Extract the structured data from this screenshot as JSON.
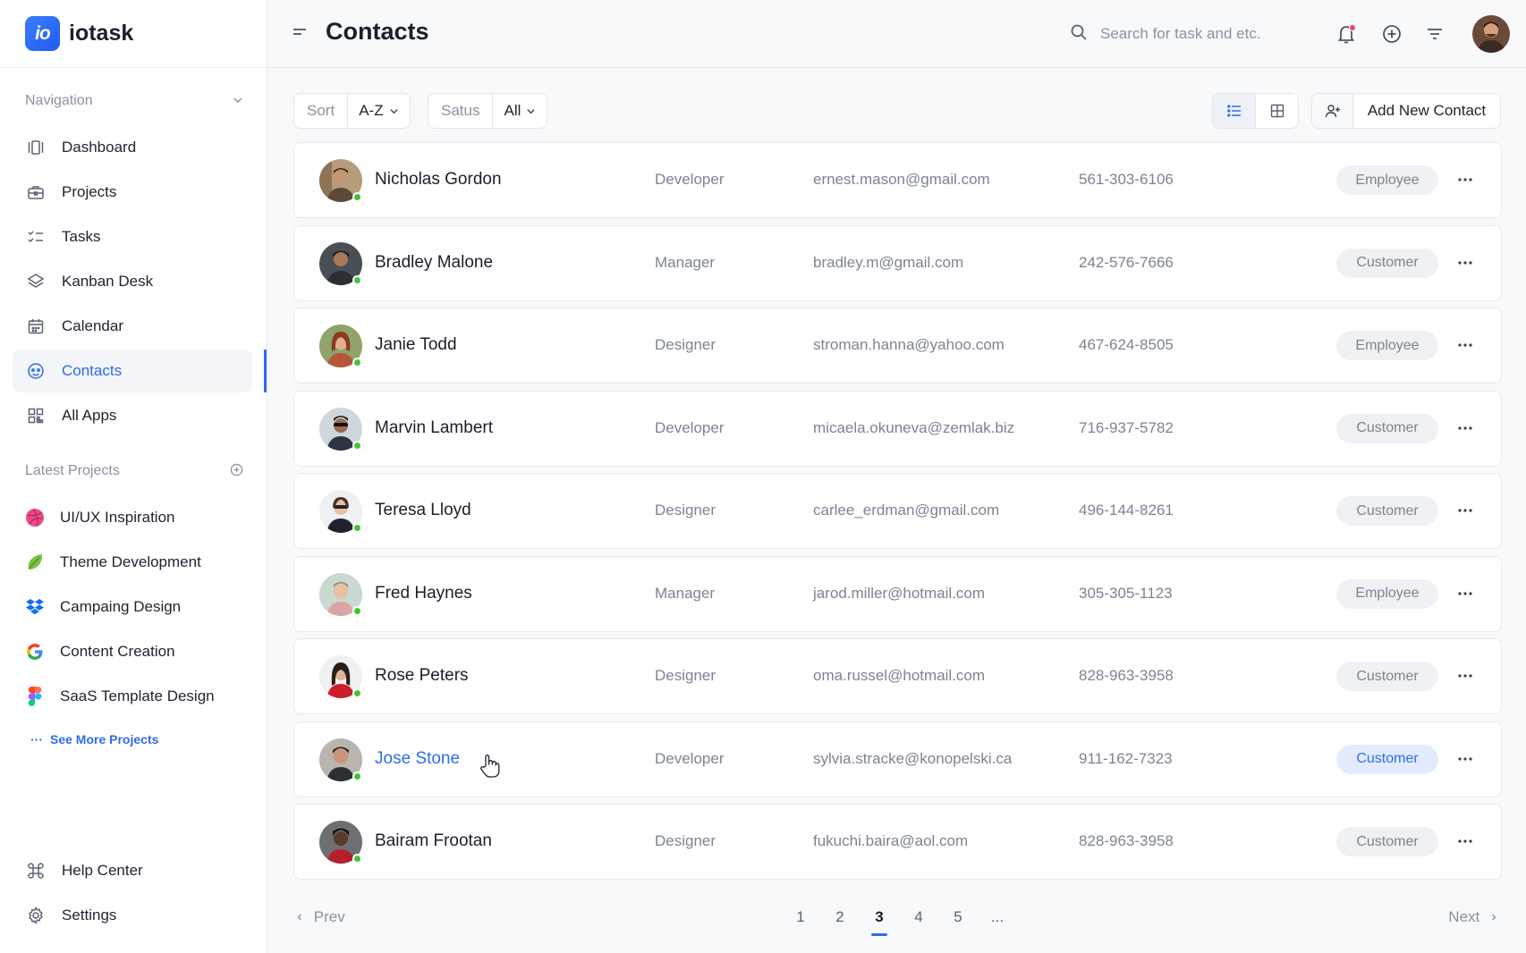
{
  "app": {
    "logo_text": "io",
    "name": "iotask"
  },
  "sidebar": {
    "nav_heading": "Navigation",
    "nav_items": [
      {
        "label": "Dashboard",
        "icon": "dashboard-icon"
      },
      {
        "label": "Projects",
        "icon": "briefcase-icon"
      },
      {
        "label": "Tasks",
        "icon": "checklist-icon"
      },
      {
        "label": "Kanban Desk",
        "icon": "layers-icon"
      },
      {
        "label": "Calendar",
        "icon": "calendar-icon"
      },
      {
        "label": "Contacts",
        "icon": "contacts-icon",
        "active": true
      },
      {
        "label": "All Apps",
        "icon": "apps-grid-icon"
      }
    ],
    "projects_heading": "Latest Projects",
    "projects": [
      {
        "label": "UI/UX Inspiration",
        "icon": "dribbble-icon"
      },
      {
        "label": "Theme Development",
        "icon": "leaf-icon"
      },
      {
        "label": "Campaing Design",
        "icon": "dropbox-icon"
      },
      {
        "label": "Content Creation",
        "icon": "google-icon"
      },
      {
        "label": "SaaS Template Design",
        "icon": "figma-icon"
      }
    ],
    "see_more": "See More Projects",
    "footer_items": [
      {
        "label": "Help Center",
        "icon": "command-icon"
      },
      {
        "label": "Settings",
        "icon": "gear-icon"
      }
    ]
  },
  "header": {
    "title": "Contacts",
    "search_placeholder": "Search for task and etc."
  },
  "toolbar": {
    "sort_label": "Sort",
    "sort_value": "A-Z",
    "status_label": "Satus",
    "status_value": "All",
    "add_button": "Add New Contact"
  },
  "contacts": [
    {
      "name": "Nicholas Gordon",
      "role": "Developer",
      "email": "ernest.mason@gmail.com",
      "phone": "561-303-6106",
      "type": "Employee"
    },
    {
      "name": "Bradley Malone",
      "role": "Manager",
      "email": "bradley.m@gmail.com",
      "phone": "242-576-7666",
      "type": "Customer"
    },
    {
      "name": "Janie Todd",
      "role": "Designer",
      "email": "stroman.hanna@yahoo.com",
      "phone": "467-624-8505",
      "type": "Employee"
    },
    {
      "name": "Marvin Lambert",
      "role": "Developer",
      "email": "micaela.okuneva@zemlak.biz",
      "phone": "716-937-5782",
      "type": "Customer"
    },
    {
      "name": "Teresa Lloyd",
      "role": "Designer",
      "email": "carlee_erdman@gmail.com",
      "phone": "496-144-8261",
      "type": "Customer"
    },
    {
      "name": "Fred Haynes",
      "role": "Manager",
      "email": "jarod.miller@hotmail.com",
      "phone": "305-305-1123",
      "type": "Employee"
    },
    {
      "name": "Rose Peters",
      "role": "Designer",
      "email": "oma.russel@hotmail.com",
      "phone": "828-963-3958",
      "type": "Customer"
    },
    {
      "name": "Jose Stone",
      "role": "Developer",
      "email": "sylvia.stracke@konopelski.ca",
      "phone": "911-162-7323",
      "type": "Customer"
    },
    {
      "name": "Bairam Frootan",
      "role": "Designer",
      "email": "fukuchi.baira@aol.com",
      "phone": "828-963-3958",
      "type": "Customer"
    }
  ],
  "pagination": {
    "prev": "Prev",
    "next": "Next",
    "pages": [
      "1",
      "2",
      "3",
      "4",
      "5",
      "..."
    ],
    "current": "3"
  },
  "colors": {
    "accent": "#2f6bf0",
    "online": "#45c23a",
    "notification": "#ff3c78"
  }
}
